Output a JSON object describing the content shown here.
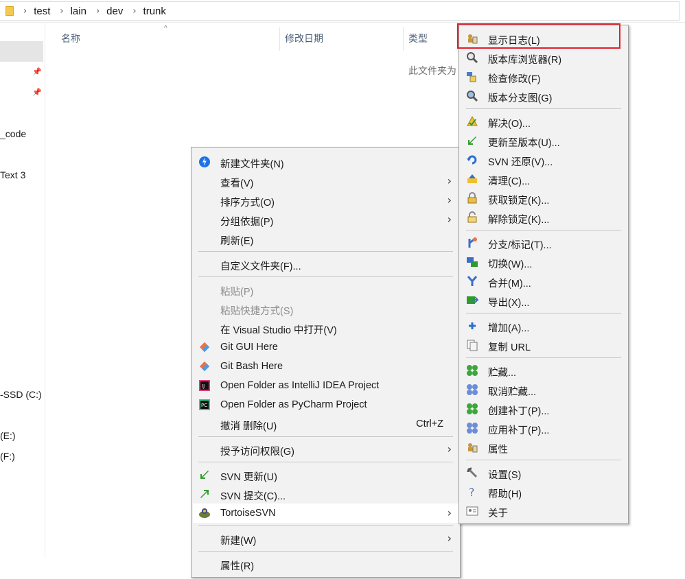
{
  "breadcrumb": [
    "test",
    "lain",
    "dev",
    "trunk"
  ],
  "nav": {
    "items": [
      "_code",
      "Text 3",
      "-SSD (C:)",
      "(E:)",
      "(F:)"
    ]
  },
  "columns": {
    "name": "名称",
    "modified": "修改日期",
    "type": "类型"
  },
  "empty_message": "此文件夹为",
  "context_menu": {
    "items": [
      {
        "label": "新建文件夹(N)",
        "icon": "new-folder-icon",
        "enabled": true
      },
      {
        "label": "查看(V)",
        "submenu": true,
        "enabled": true
      },
      {
        "label": "排序方式(O)",
        "submenu": true,
        "enabled": true
      },
      {
        "label": "分组依据(P)",
        "submenu": true,
        "enabled": true
      },
      {
        "label": "刷新(E)",
        "enabled": true
      },
      {
        "label": "自定义文件夹(F)...",
        "enabled": true
      },
      {
        "label": "粘贴(P)",
        "enabled": false
      },
      {
        "label": "粘贴快捷方式(S)",
        "enabled": false
      },
      {
        "label": "在 Visual Studio 中打开(V)",
        "enabled": true
      },
      {
        "label": "Git GUI Here",
        "icon": "git-icon",
        "enabled": true
      },
      {
        "label": "Git Bash Here",
        "icon": "git-icon",
        "enabled": true
      },
      {
        "label": "Open Folder as IntelliJ IDEA Project",
        "icon": "intellij-icon",
        "enabled": true
      },
      {
        "label": "Open Folder as PyCharm Project",
        "icon": "pycharm-icon",
        "enabled": true
      },
      {
        "label": "撤消 删除(U)",
        "shortcut": "Ctrl+Z",
        "enabled": true
      },
      {
        "label": "授予访问权限(G)",
        "submenu": true,
        "enabled": true
      },
      {
        "label": "SVN 更新(U)",
        "icon": "svn-update-icon",
        "enabled": true
      },
      {
        "label": "SVN 提交(C)...",
        "icon": "svn-commit-icon",
        "enabled": true
      },
      {
        "label": "TortoiseSVN",
        "icon": "tortoise-icon",
        "submenu": true,
        "enabled": true,
        "highlighted": true
      },
      {
        "label": "新建(W)",
        "submenu": true,
        "enabled": true
      },
      {
        "label": "属性(R)",
        "enabled": true
      }
    ]
  },
  "svn_submenu": {
    "items": [
      {
        "label": "显示日志(L)",
        "icon": "show-log-icon"
      },
      {
        "label": "版本库浏览器(R)",
        "icon": "repo-browser-icon"
      },
      {
        "label": "检查修改(F)",
        "icon": "check-mods-icon"
      },
      {
        "label": "版本分支图(G)",
        "icon": "revision-graph-icon"
      },
      {
        "label": "解决(O)...",
        "icon": "resolve-icon"
      },
      {
        "label": "更新至版本(U)...",
        "icon": "update-to-rev-icon"
      },
      {
        "label": "SVN 还原(V)...",
        "icon": "revert-icon"
      },
      {
        "label": "清理(C)...",
        "icon": "cleanup-icon"
      },
      {
        "label": "获取锁定(K)...",
        "icon": "lock-icon"
      },
      {
        "label": "解除锁定(K)...",
        "icon": "unlock-icon"
      },
      {
        "label": "分支/标记(T)...",
        "icon": "branch-icon"
      },
      {
        "label": "切换(W)...",
        "icon": "switch-icon"
      },
      {
        "label": "合并(M)...",
        "icon": "merge-icon"
      },
      {
        "label": "导出(X)...",
        "icon": "export-icon"
      },
      {
        "label": "增加(A)...",
        "icon": "add-icon"
      },
      {
        "label": "复制 URL",
        "icon": "copy-url-icon"
      },
      {
        "label": "贮藏...",
        "icon": "shelve-icon"
      },
      {
        "label": "取消贮藏...",
        "icon": "unshelve-icon"
      },
      {
        "label": "创建补丁(P)...",
        "icon": "create-patch-icon"
      },
      {
        "label": "应用补丁(P)...",
        "icon": "apply-patch-icon"
      },
      {
        "label": "属性",
        "icon": "properties-icon"
      },
      {
        "label": "设置(S)",
        "icon": "settings-icon"
      },
      {
        "label": "帮助(H)",
        "icon": "help-icon"
      },
      {
        "label": "关于",
        "icon": "about-icon"
      }
    ]
  },
  "colors": {
    "highlight_border": "#e0202c",
    "menu_bg": "#f2f2f2",
    "header_text": "#4c607a"
  }
}
